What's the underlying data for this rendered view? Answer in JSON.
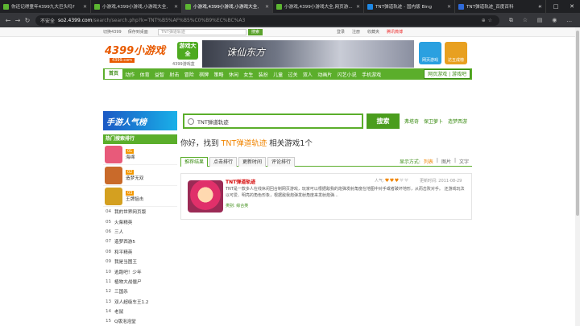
{
  "browser": {
    "tabs": [
      {
        "title": "你还记得童年4399九大巨头吗?"
      },
      {
        "title": "小游戏,4399小游戏,小游戏大全,"
      },
      {
        "title": "小游戏,4399小游戏,小游戏大全,"
      },
      {
        "title": "小游戏,4399小游戏大全,网页游..."
      },
      {
        "title": "TNT弹道轨迹 - 国内版 Bing"
      },
      {
        "title": "TNT弹道轨迹_百度百科"
      }
    ],
    "address": {
      "warning": "不安全",
      "host": "so2.4399.com",
      "path": "/search/search.php?k=TNT%B5%AF%B5%C0%B9%EC%BC%A3"
    }
  },
  "topstrip": {
    "left_links": [
      "切换4399",
      "保存到桌面"
    ],
    "search_placeholder": "TNT弹道轨迹",
    "search_button": "搜索",
    "right_links": [
      "登录",
      "注册",
      "收藏夹"
    ],
    "favorites_link": "腾讯微博"
  },
  "header": {
    "logo_text": "4399小游戏",
    "logo_sub": "4399.com",
    "box_logo": "游戏大全",
    "box_sub": "4399游戏盒",
    "banner_text": "诛仙东方",
    "right_buttons": [
      {
        "label": "网页游戏",
        "color": "#2aa0e0"
      },
      {
        "label": "达五成榜",
        "color": "#e8a020"
      }
    ]
  },
  "nav": {
    "home": "首页",
    "items": [
      "动作",
      "体育",
      "益智",
      "射击",
      "冒险",
      "棋牌",
      "策略",
      "休闲",
      "女生",
      "装扮",
      "儿童",
      "过关",
      "双人",
      "动画片",
      "闪艺小说",
      "手机游戏"
    ],
    "right": "网页游戏 | 游戏吧"
  },
  "hot_banner": "手游人气榜",
  "search": {
    "value": "TNT弹道轨迹",
    "button": "搜索",
    "hot_words": [
      "弗塔奇",
      "保卫萝卜",
      "造梦西游"
    ]
  },
  "sidebar": {
    "title": "热门搜索排行",
    "top": [
      {
        "rank": "01",
        "name": "海绵",
        "color": "#e85a7a"
      },
      {
        "rank": "02",
        "name": "造梦无双",
        "color": "#c96a2a"
      },
      {
        "rank": "03",
        "name": "王牌狙击",
        "color": "#d4a020"
      }
    ],
    "list": [
      {
        "rank": "04",
        "name": "我的世界网页版"
      },
      {
        "rank": "05",
        "name": "火柴精英"
      },
      {
        "rank": "06",
        "name": "三人"
      },
      {
        "rank": "07",
        "name": "造梦西游5"
      },
      {
        "rank": "08",
        "name": "和平精英"
      },
      {
        "rank": "09",
        "name": "我是当图王"
      },
      {
        "rank": "10",
        "name": "逃跑吧！少年"
      },
      {
        "rank": "11",
        "name": "植物大战僵尸"
      },
      {
        "rank": "12",
        "name": "三国杀"
      },
      {
        "rank": "13",
        "name": "双人超级车王1.2"
      },
      {
        "rank": "14",
        "name": "老鼠"
      },
      {
        "rank": "15",
        "name": "Q版泡泡堂"
      }
    ]
  },
  "results": {
    "prefix": "你好，找到",
    "keyword": "TNT弹道轨迹",
    "suffix": "相关游戏1个",
    "tabs": [
      "推荐结果",
      "点击排行",
      "更新时间",
      "评论排行"
    ],
    "view_label": "显示方式:",
    "view_modes": [
      "列表",
      "图片",
      "文字"
    ],
    "items": [
      {
        "name": "TNT弹道轨迹",
        "popularity_label": "人气:",
        "popularity": 3,
        "popularity_max": 5,
        "updated": "更新时间: 2011-08-29",
        "description": "TNT是一款多人在线休闲回合制网页游戏，玩家可以根据敌我的炮弹发射角度在地图中对手或者破坏地形，从而击败对手。  还游戏玩法以可爱、明亮的角色形象，根据敌我炮弹发射角度来发射炮弹...",
        "category_label": "类别:",
        "category": "综合类"
      }
    ]
  }
}
